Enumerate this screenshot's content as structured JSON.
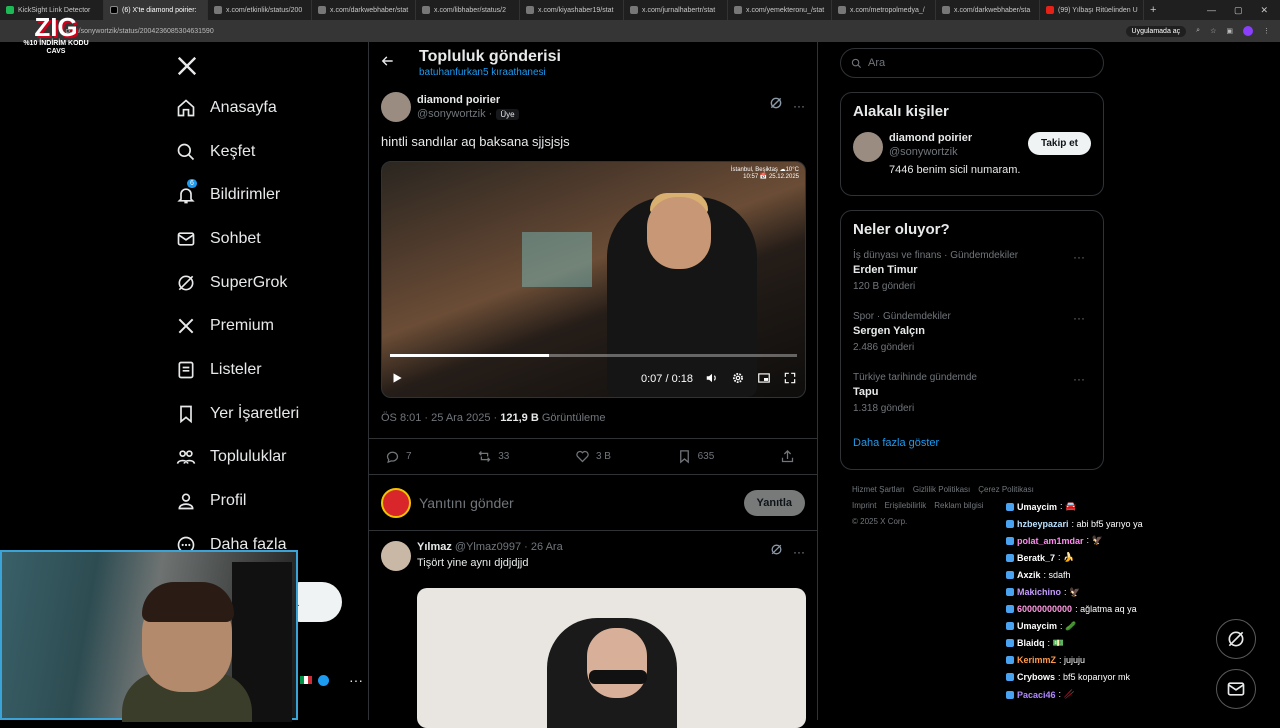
{
  "browser": {
    "tabs": [
      {
        "label": "KickSight Link Detector",
        "active": false
      },
      {
        "label": "(6) X'te diamond poirier:",
        "active": true
      },
      {
        "label": "x.com/etkinlik/status/200",
        "active": false
      },
      {
        "label": "x.com/darkwebhaber/stat",
        "active": false
      },
      {
        "label": "x.com/libhaber/status/2",
        "active": false
      },
      {
        "label": "x.com/kiyashaber19/stat",
        "active": false
      },
      {
        "label": "x.com/jurnalhabertr/stat",
        "active": false
      },
      {
        "label": "x.com/yemekteronu_/stat",
        "active": false
      },
      {
        "label": "x.com/metropolmedya_/",
        "active": false
      },
      {
        "label": "x.com/darkwebhaber/sta",
        "active": false
      },
      {
        "label": "(99) Yılbaşı Ritüelinden U",
        "active": false
      }
    ],
    "url": "x.com/sonywortzik/status/2004236085304631590",
    "app_chip": "Uygulamada aç",
    "overlay_logo": {
      "big": "ZIG",
      "line1": "%10 İNDİRİM KODU",
      "line2": "CAVS"
    }
  },
  "nav": {
    "items": [
      {
        "label": "Anasayfa",
        "icon": "home-icon"
      },
      {
        "label": "Keşfet",
        "icon": "search-icon"
      },
      {
        "label": "Bildirimler",
        "icon": "bell-icon",
        "badge": "6"
      },
      {
        "label": "Sohbet",
        "icon": "mail-icon"
      },
      {
        "label": "SuperGrok",
        "icon": "grok-icon"
      },
      {
        "label": "Premium",
        "icon": "x-icon"
      },
      {
        "label": "Listeler",
        "icon": "list-icon"
      },
      {
        "label": "Yer İşaretleri",
        "icon": "bookmark-icon"
      },
      {
        "label": "Topluluklar",
        "icon": "people-icon"
      },
      {
        "label": "Profil",
        "icon": "person-icon"
      },
      {
        "label": "Daha fazla",
        "icon": "more-icon"
      }
    ],
    "post_button": "a"
  },
  "main": {
    "title": "Topluluk gönderisi",
    "subtitle": "batuhanfurkan5 kıraathanesi",
    "author_name": "diamond poirier",
    "author_handle": "@sonywortzik ·",
    "member_badge": "Üye",
    "text": "hintli sandılar aq baksana sjjsjsjs",
    "video": {
      "stamp1": "İstanbul, Beşiktaş ☁10°C",
      "stamp2": "10:57 📅 25.12.2025",
      "time": "0:07 / 0:18",
      "progress": 0.39
    },
    "time_label": "ÖS 8:01 · 25 Ara 2025 · ",
    "views_count": "121,9 B",
    "views_label": "Görüntüleme",
    "stats": {
      "replies": "7",
      "reposts": "33",
      "likes": "3 B",
      "bookmarks": "635"
    },
    "reply_placeholder": "Yanıtını gönder",
    "reply_button": "Yanıtla",
    "reply_tweet": {
      "name": "Yılmaz",
      "meta": "@Ylmaz0997 · 26 Ara",
      "text": "Tişört yine aynı djdjdjjd"
    }
  },
  "right": {
    "search_placeholder": "Ara",
    "related_title": "Alakalı kişiler",
    "person": {
      "name": "diamond poirier",
      "handle": "@sonywortzik",
      "bio": "7446 benim sicil numaram.",
      "follow": "Takip et"
    },
    "trends_title": "Neler oluyor?",
    "trends": [
      {
        "context": "İş dünyası ve finans · Gündemdekiler",
        "name": "Erden Timur",
        "count": "120 B gönderi"
      },
      {
        "context": "Spor · Gündemdekiler",
        "name": "Sergen Yalçın",
        "count": "2.486 gönderi"
      },
      {
        "context": "Türkiye tarihinde gündemde",
        "name": "Tapu",
        "count": "1.318 gönderi"
      }
    ],
    "show_more": "Daha fazla göster",
    "footer": {
      "l1a": "Hizmet Şartları",
      "l1b": "Gizlilik Politikası",
      "l1c": "Çerez Politikası",
      "l2a": "Imprint",
      "l2b": "Erişilebilirlik",
      "l2c": "Reklam bilgisi",
      "copy": "© 2025 X Corp."
    }
  },
  "chat": [
    {
      "user": "Umaycim",
      "msg": ": 🚘",
      "color": "#ffffff"
    },
    {
      "user": "hzbeypazari",
      "msg": ": abi bf5 yarıyo ya",
      "color": "#b8e0ff"
    },
    {
      "user": "polat_am1mdar",
      "msg": ": 🦅",
      "color": "#ff8bf0"
    },
    {
      "user": "Beratk_7",
      "msg": ": 🍌",
      "color": "#ffffff"
    },
    {
      "user": "Axzik",
      "msg": ": sdafh",
      "color": "#ffffff"
    },
    {
      "user": "Makichino",
      "msg": ": 🦅",
      "color": "#c59bff"
    },
    {
      "user": "60000000000",
      "msg": ": ağlatma aq ya",
      "color": "#ff9be3"
    },
    {
      "user": "Umaycim",
      "msg": ": 🥒",
      "color": "#ffffff"
    },
    {
      "user": "Blaidq",
      "msg": ": 💵",
      "color": "#ffffff"
    },
    {
      "user": "KerimmZ",
      "msg": ": jujuju",
      "color": "#ff9a4a"
    },
    {
      "user": "Crybows",
      "msg": ": bf5 koparıyor mk",
      "color": "#ffffff"
    },
    {
      "user": "Pacaci46",
      "msg": ": 🥢",
      "color": "#b08aff"
    }
  ]
}
